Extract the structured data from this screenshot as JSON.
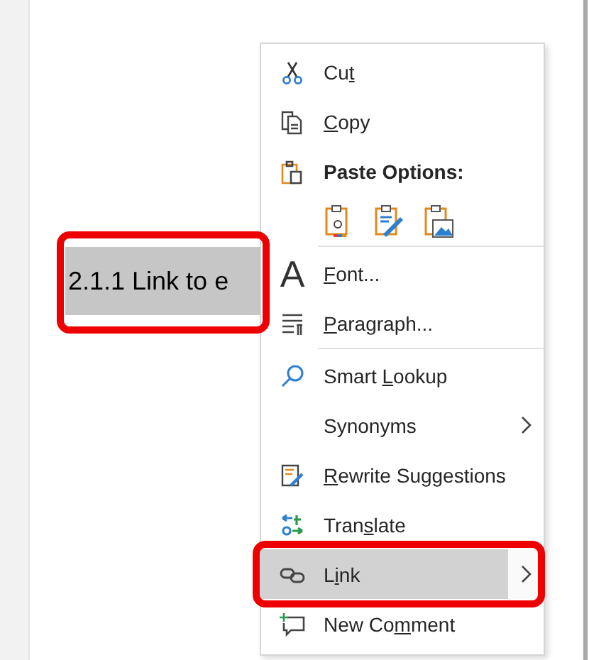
{
  "document": {
    "heading": "2.1.1 Link to e",
    "selected": true,
    "annotated": true
  },
  "context_menu": {
    "items": [
      {
        "kind": "command",
        "label": [
          {
            "text": "Cu",
            "underline": false
          },
          {
            "text": "t",
            "underline": true
          }
        ],
        "separator_before": false,
        "submenu": false,
        "highlighted": false,
        "annotated": false
      },
      {
        "kind": "command",
        "label": [
          {
            "text": "C",
            "underline": true
          },
          {
            "text": "opy",
            "underline": false
          }
        ],
        "separator_before": false,
        "submenu": false,
        "highlighted": false,
        "annotated": false
      },
      {
        "kind": "header",
        "label": [
          {
            "text": "Paste Options:",
            "underline": false
          }
        ],
        "separator_before": false,
        "submenu": false,
        "highlighted": false,
        "annotated": false
      },
      {
        "kind": "paste-options",
        "separator_before": false,
        "submenu": false,
        "highlighted": false,
        "annotated": false
      },
      {
        "kind": "command",
        "icon_glyph": "A",
        "label": [
          {
            "text": "F",
            "underline": true
          },
          {
            "text": "ont...",
            "underline": false
          }
        ],
        "separator_before": true,
        "submenu": false,
        "highlighted": false,
        "annotated": false
      },
      {
        "kind": "command",
        "label": [
          {
            "text": "P",
            "underline": true
          },
          {
            "text": "aragraph...",
            "underline": false
          }
        ],
        "separator_before": false,
        "submenu": false,
        "highlighted": false,
        "annotated": false
      },
      {
        "kind": "command",
        "label": [
          {
            "text": "Smart ",
            "underline": false
          },
          {
            "text": "L",
            "underline": true
          },
          {
            "text": "ookup",
            "underline": false
          }
        ],
        "separator_before": true,
        "submenu": false,
        "highlighted": false,
        "annotated": false
      },
      {
        "kind": "command",
        "label": [
          {
            "text": "Synonyms",
            "underline": false
          }
        ],
        "separator_before": false,
        "submenu": true,
        "highlighted": false,
        "annotated": false
      },
      {
        "kind": "command",
        "label": [
          {
            "text": "R",
            "underline": true
          },
          {
            "text": "ewrite Suggestions",
            "underline": false
          }
        ],
        "separator_before": false,
        "submenu": false,
        "highlighted": false,
        "annotated": false
      },
      {
        "kind": "command",
        "label": [
          {
            "text": "Tran",
            "underline": false
          },
          {
            "text": "s",
            "underline": true
          },
          {
            "text": "late",
            "underline": false
          }
        ],
        "separator_before": false,
        "submenu": false,
        "highlighted": false,
        "annotated": false
      },
      {
        "kind": "command",
        "label": [
          {
            "text": "L",
            "underline": false
          },
          {
            "text": "i",
            "underline": true
          },
          {
            "text": "nk",
            "underline": false
          }
        ],
        "separator_before": false,
        "submenu": true,
        "highlighted": true,
        "annotated": true
      },
      {
        "kind": "command",
        "label": [
          {
            "text": "New Co",
            "underline": false
          },
          {
            "text": "m",
            "underline": true
          },
          {
            "text": "ment",
            "underline": false
          }
        ],
        "separator_before": false,
        "submenu": false,
        "highlighted": false,
        "annotated": false
      }
    ]
  }
}
